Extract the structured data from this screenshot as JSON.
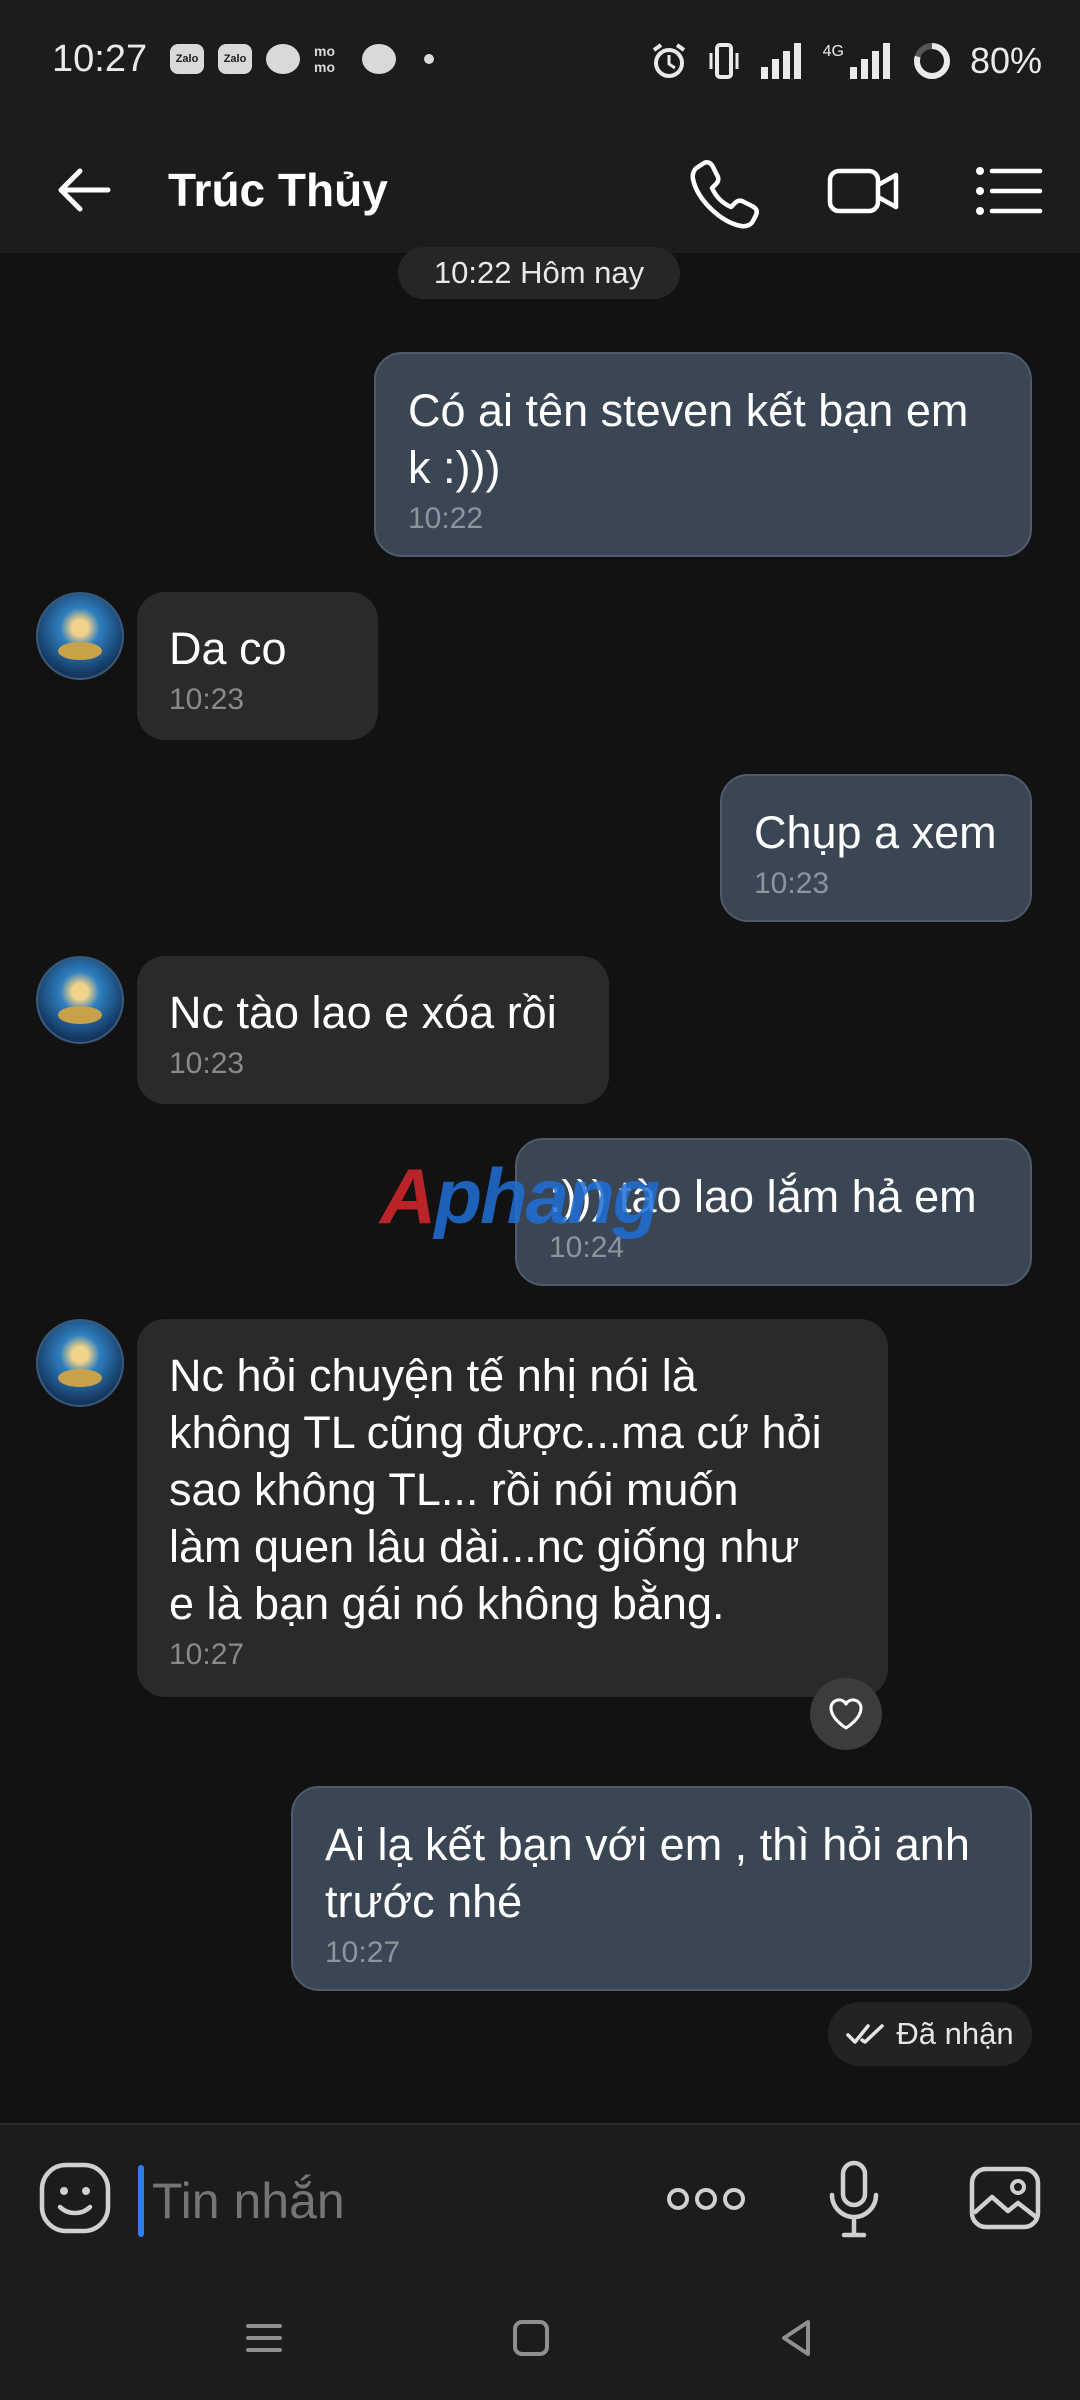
{
  "status_bar": {
    "time": "10:27",
    "apps": [
      "Zalo",
      "Zalo",
      "",
      "mo mo",
      ""
    ],
    "battery": "80%",
    "network": "4G"
  },
  "header": {
    "back_icon": "arrow-left-icon",
    "title": "Trúc Thủy",
    "call_icon": "phone-icon",
    "video_icon": "video-camera-icon",
    "menu_icon": "menu-list-icon"
  },
  "chat": {
    "date_label": "10:22 Hôm nay",
    "messages": [
      {
        "direction": "out",
        "text": "Có ai tên steven kết bạn em\nk :)))",
        "time": "10:22"
      },
      {
        "direction": "in",
        "text": "Da co",
        "time": "10:23"
      },
      {
        "direction": "out",
        "text": "Chụp a xem",
        "time": "10:23"
      },
      {
        "direction": "in",
        "text": "Nc tào lao e xóa rồi",
        "time": "10:23"
      },
      {
        "direction": "out",
        "text": ":))) tào lao lắm hả em",
        "time": "10:24"
      },
      {
        "direction": "in",
        "text": "Nc hỏi chuyện tế nhị nói là\nkhông TL cũng được...ma cứ hỏi\nsao không TL... rồi nói muốn\nlàm quen lâu dài...nc giống như\ne là bạn gái nó không bằng.",
        "time": "10:27"
      },
      {
        "direction": "out",
        "text": "Ai lạ kết bạn với em , thì hỏi anh\ntrước nhé",
        "time": "10:27"
      }
    ],
    "received_status": "Đã nhận",
    "watermark": "Aphang"
  },
  "composer": {
    "placeholder": "Tin nhắn",
    "emoji_icon": "sticker-face-icon",
    "more_icon": "more-dots-icon",
    "mic_icon": "microphone-icon",
    "image_icon": "image-gallery-icon"
  },
  "colors": {
    "background": "#121212",
    "bar": "#1c1c1c",
    "outgoing_bubble": "#3b4654",
    "incoming_bubble": "#2a2a2a",
    "caret": "#2f7cf6"
  }
}
